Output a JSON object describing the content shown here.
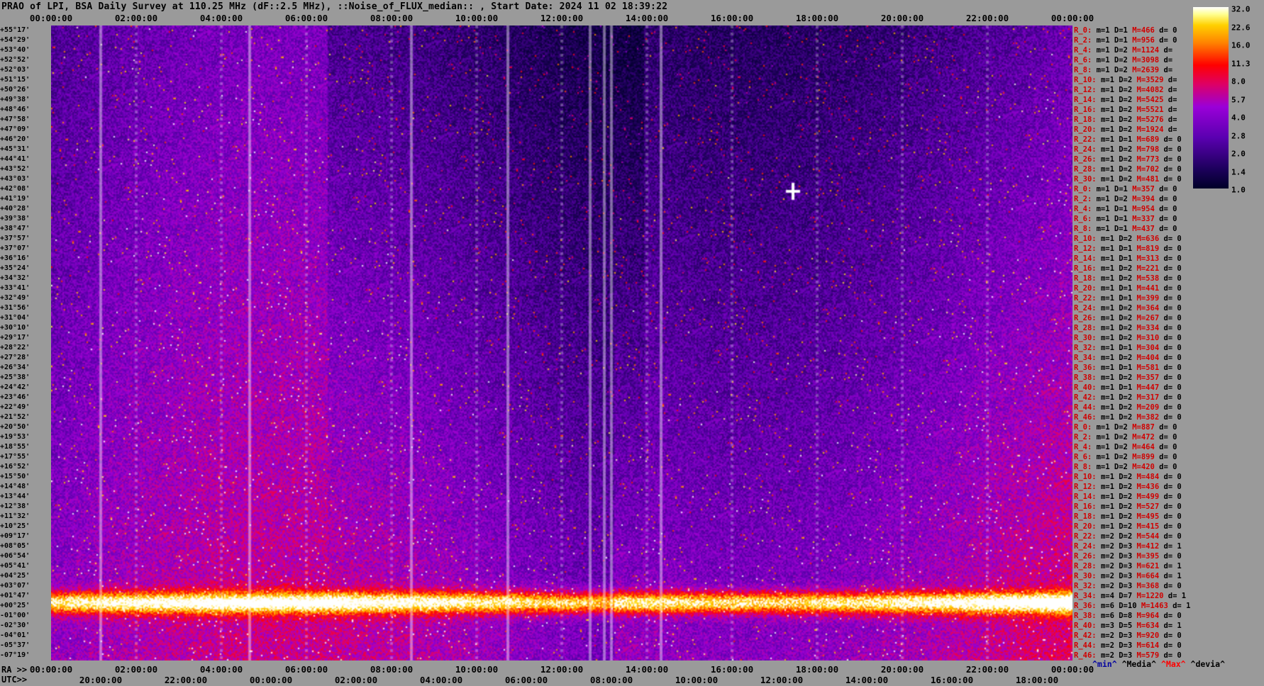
{
  "title": "PRAO of LPI, BSA Daily Survey at 110.25 MHz (dF::2.5 MHz), ::Noise_of_FLUX_median:: , Start Date: 2024 11 02 18:39:22",
  "axis_top": [
    "00:00:00",
    "02:00:00",
    "04:00:00",
    "06:00:00",
    "08:00:00",
    "10:00:00",
    "12:00:00",
    "14:00:00",
    "16:00:00",
    "18:00:00",
    "20:00:00",
    "22:00:00",
    "00:00:00"
  ],
  "axis_ra_label": "RA >>",
  "axis_ra": [
    "00:00:00",
    "02:00:00",
    "04:00:00",
    "06:00:00",
    "08:00:00",
    "10:00:00",
    "12:00:00",
    "14:00:00",
    "16:00:00",
    "18:00:00",
    "20:00:00",
    "22:00:00",
    "00:00:00"
  ],
  "axis_utc_label": "UTC>>",
  "axis_utc": [
    "20:00:00",
    "22:00:00",
    "00:00:00",
    "02:00:00",
    "04:00:00",
    "06:00:00",
    "08:00:00",
    "10:00:00",
    "12:00:00",
    "14:00:00",
    "16:00:00",
    "18:00:00"
  ],
  "declinations": [
    "+55°17'",
    "+54°29'",
    "+53°40'",
    "+52°52'",
    "+52°03'",
    "+51°15'",
    "+50°26'",
    "+49°38'",
    "+48°46'",
    "+47°58'",
    "+47°09'",
    "+46°20'",
    "+45°31'",
    "+44°41'",
    "+43°52'",
    "+43°03'",
    "+42°08'",
    "+41°19'",
    "+40°28'",
    "+39°38'",
    "+38°47'",
    "+37°57'",
    "+37°07'",
    "+36°16'",
    "+35°24'",
    "+34°32'",
    "+33°41'",
    "+32°49'",
    "+31°56'",
    "+31°04'",
    "+30°10'",
    "+29°17'",
    "+28°22'",
    "+27°28'",
    "+26°34'",
    "+25°38'",
    "+24°42'",
    "+23°46'",
    "+22°49'",
    "+21°52'",
    "+20°50'",
    "+19°53'",
    "+18°55'",
    "+17°55'",
    "+16°52'",
    "+15°50'",
    "+14°48'",
    "+13°44'",
    "+12°38'",
    "+11°32'",
    "+10°25'",
    "+09°17'",
    "+08°05'",
    "+06°54'",
    "+05°41'",
    "+04°25'",
    "+03°07'",
    "+01°47'",
    "+00°25'",
    "-01°00'",
    "-02°30'",
    "-04°01'",
    "-05°37'",
    "-07°19'"
  ],
  "stats": [
    [
      "R_0:",
      "m=1",
      "D=1",
      "M=466",
      "d= 0"
    ],
    [
      "R_2:",
      "m=1",
      "D=1",
      "M=956",
      "d= 0"
    ],
    [
      "R_4:",
      "m=1",
      "D=2",
      "M=1124",
      "d="
    ],
    [
      "R_6:",
      "m=1",
      "D=2",
      "M=3098",
      "d="
    ],
    [
      "R_8:",
      "m=1",
      "D=2",
      "M=2639",
      "d="
    ],
    [
      "R_10:",
      "m=1",
      "D=2",
      "M=3529",
      "d="
    ],
    [
      "R_12:",
      "m=1",
      "D=2",
      "M=4082",
      "d="
    ],
    [
      "R_14:",
      "m=1",
      "D=2",
      "M=5425",
      "d="
    ],
    [
      "R_16:",
      "m=1",
      "D=2",
      "M=5521",
      "d="
    ],
    [
      "R_18:",
      "m=1",
      "D=2",
      "M=5276",
      "d="
    ],
    [
      "R_20:",
      "m=1",
      "D=2",
      "M=1924",
      "d="
    ],
    [
      "R_22:",
      "m=1",
      "D=1",
      "M=689",
      "d= 0"
    ],
    [
      "R_24:",
      "m=1",
      "D=2",
      "M=798",
      "d= 0"
    ],
    [
      "R_26:",
      "m=1",
      "D=2",
      "M=773",
      "d= 0"
    ],
    [
      "R_28:",
      "m=1",
      "D=2",
      "M=702",
      "d= 0"
    ],
    [
      "R_30:",
      "m=1",
      "D=2",
      "M=481",
      "d= 0"
    ],
    [
      "R_0:",
      "m=1",
      "D=1",
      "M=357",
      "d= 0"
    ],
    [
      "R_2:",
      "m=1",
      "D=2",
      "M=394",
      "d= 0"
    ],
    [
      "R_4:",
      "m=1",
      "D=1",
      "M=954",
      "d= 0"
    ],
    [
      "R_6:",
      "m=1",
      "D=1",
      "M=337",
      "d= 0"
    ],
    [
      "R_8:",
      "m=1",
      "D=1",
      "M=437",
      "d= 0"
    ],
    [
      "R_10:",
      "m=1",
      "D=2",
      "M=636",
      "d= 0"
    ],
    [
      "R_12:",
      "m=1",
      "D=1",
      "M=819",
      "d= 0"
    ],
    [
      "R_14:",
      "m=1",
      "D=1",
      "M=313",
      "d= 0"
    ],
    [
      "R_16:",
      "m=1",
      "D=2",
      "M=221",
      "d= 0"
    ],
    [
      "R_18:",
      "m=1",
      "D=2",
      "M=538",
      "d= 0"
    ],
    [
      "R_20:",
      "m=1",
      "D=1",
      "M=441",
      "d= 0"
    ],
    [
      "R_22:",
      "m=1",
      "D=1",
      "M=399",
      "d= 0"
    ],
    [
      "R_24:",
      "m=1",
      "D=2",
      "M=364",
      "d= 0"
    ],
    [
      "R_26:",
      "m=1",
      "D=2",
      "M=267",
      "d= 0"
    ],
    [
      "R_28:",
      "m=1",
      "D=2",
      "M=334",
      "d= 0"
    ],
    [
      "R_30:",
      "m=1",
      "D=2",
      "M=310",
      "d= 0"
    ],
    [
      "R_32:",
      "m=1",
      "D=1",
      "M=304",
      "d= 0"
    ],
    [
      "R_34:",
      "m=1",
      "D=2",
      "M=404",
      "d= 0"
    ],
    [
      "R_36:",
      "m=1",
      "D=1",
      "M=581",
      "d= 0"
    ],
    [
      "R_38:",
      "m=1",
      "D=2",
      "M=357",
      "d= 0"
    ],
    [
      "R_40:",
      "m=1",
      "D=1",
      "M=447",
      "d= 0"
    ],
    [
      "R_42:",
      "m=1",
      "D=2",
      "M=317",
      "d= 0"
    ],
    [
      "R_44:",
      "m=1",
      "D=2",
      "M=209",
      "d= 0"
    ],
    [
      "R_46:",
      "m=1",
      "D=2",
      "M=382",
      "d= 0"
    ],
    [
      "R_0:",
      "m=1",
      "D=2",
      "M=887",
      "d= 0"
    ],
    [
      "R_2:",
      "m=1",
      "D=2",
      "M=472",
      "d= 0"
    ],
    [
      "R_4:",
      "m=1",
      "D=2",
      "M=464",
      "d= 0"
    ],
    [
      "R_6:",
      "m=1",
      "D=2",
      "M=899",
      "d= 0"
    ],
    [
      "R_8:",
      "m=1",
      "D=2",
      "M=420",
      "d= 0"
    ],
    [
      "R_10:",
      "m=1",
      "D=2",
      "M=484",
      "d= 0"
    ],
    [
      "R_12:",
      "m=1",
      "D=2",
      "M=436",
      "d= 0"
    ],
    [
      "R_14:",
      "m=1",
      "D=2",
      "M=499",
      "d= 0"
    ],
    [
      "R_16:",
      "m=1",
      "D=2",
      "M=527",
      "d= 0"
    ],
    [
      "R_18:",
      "m=1",
      "D=2",
      "M=495",
      "d= 0"
    ],
    [
      "R_20:",
      "m=1",
      "D=2",
      "M=415",
      "d= 0"
    ],
    [
      "R_22:",
      "m=2",
      "D=2",
      "M=544",
      "d= 0"
    ],
    [
      "R_24:",
      "m=2",
      "D=3",
      "M=412",
      "d= 1"
    ],
    [
      "R_26:",
      "m=2",
      "D=3",
      "M=395",
      "d= 0"
    ],
    [
      "R_28:",
      "m=2",
      "D=3",
      "M=621",
      "d= 1"
    ],
    [
      "R_30:",
      "m=2",
      "D=3",
      "M=664",
      "d= 1"
    ],
    [
      "R_32:",
      "m=2",
      "D=3",
      "M=368",
      "d= 0"
    ],
    [
      "R_34:",
      "m=4",
      "D=7",
      "M=1220",
      "d= 1"
    ],
    [
      "R_36:",
      "m=6",
      "D=10",
      "M=1463",
      "d= 1"
    ],
    [
      "R_38:",
      "m=6",
      "D=8",
      "M=964",
      "d= 0"
    ],
    [
      "R_40:",
      "m=3",
      "D=5",
      "M=634",
      "d= 1"
    ],
    [
      "R_42:",
      "m=2",
      "D=3",
      "M=920",
      "d= 0"
    ],
    [
      "R_44:",
      "m=2",
      "D=3",
      "M=614",
      "d= 0"
    ],
    [
      "R_46:",
      "m=2",
      "D=3",
      "M=579",
      "d= 0"
    ]
  ],
  "legend_footer": {
    "min": "^min^",
    "median": "^Media^",
    "max": "^Max^",
    "devia": "^devia^"
  },
  "colorbar": {
    "labels": [
      "32.0",
      "22.6",
      "16.0",
      "11.3",
      "8.0",
      "5.7",
      "4.0",
      "2.8",
      "2.0",
      "1.4",
      "1.0"
    ],
    "colors": [
      "#000028",
      "#5a00b0",
      "#e00060",
      "#ff0000",
      "#ff8000",
      "#ffd000",
      "#ffffff"
    ]
  }
}
